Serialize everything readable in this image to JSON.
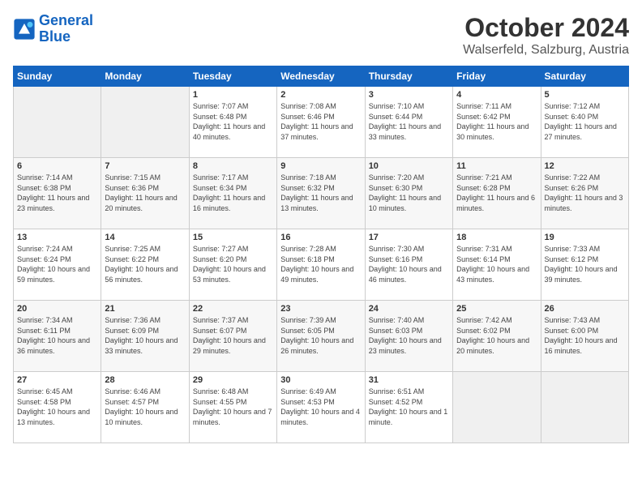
{
  "logo": {
    "line1": "General",
    "line2": "Blue"
  },
  "title": "October 2024",
  "location": "Walserfeld, Salzburg, Austria",
  "days_of_week": [
    "Sunday",
    "Monday",
    "Tuesday",
    "Wednesday",
    "Thursday",
    "Friday",
    "Saturday"
  ],
  "weeks": [
    [
      {
        "day": "",
        "sunrise": "",
        "sunset": "",
        "daylight": ""
      },
      {
        "day": "",
        "sunrise": "",
        "sunset": "",
        "daylight": ""
      },
      {
        "day": "1",
        "sunrise": "Sunrise: 7:07 AM",
        "sunset": "Sunset: 6:48 PM",
        "daylight": "Daylight: 11 hours and 40 minutes."
      },
      {
        "day": "2",
        "sunrise": "Sunrise: 7:08 AM",
        "sunset": "Sunset: 6:46 PM",
        "daylight": "Daylight: 11 hours and 37 minutes."
      },
      {
        "day": "3",
        "sunrise": "Sunrise: 7:10 AM",
        "sunset": "Sunset: 6:44 PM",
        "daylight": "Daylight: 11 hours and 33 minutes."
      },
      {
        "day": "4",
        "sunrise": "Sunrise: 7:11 AM",
        "sunset": "Sunset: 6:42 PM",
        "daylight": "Daylight: 11 hours and 30 minutes."
      },
      {
        "day": "5",
        "sunrise": "Sunrise: 7:12 AM",
        "sunset": "Sunset: 6:40 PM",
        "daylight": "Daylight: 11 hours and 27 minutes."
      }
    ],
    [
      {
        "day": "6",
        "sunrise": "Sunrise: 7:14 AM",
        "sunset": "Sunset: 6:38 PM",
        "daylight": "Daylight: 11 hours and 23 minutes."
      },
      {
        "day": "7",
        "sunrise": "Sunrise: 7:15 AM",
        "sunset": "Sunset: 6:36 PM",
        "daylight": "Daylight: 11 hours and 20 minutes."
      },
      {
        "day": "8",
        "sunrise": "Sunrise: 7:17 AM",
        "sunset": "Sunset: 6:34 PM",
        "daylight": "Daylight: 11 hours and 16 minutes."
      },
      {
        "day": "9",
        "sunrise": "Sunrise: 7:18 AM",
        "sunset": "Sunset: 6:32 PM",
        "daylight": "Daylight: 11 hours and 13 minutes."
      },
      {
        "day": "10",
        "sunrise": "Sunrise: 7:20 AM",
        "sunset": "Sunset: 6:30 PM",
        "daylight": "Daylight: 11 hours and 10 minutes."
      },
      {
        "day": "11",
        "sunrise": "Sunrise: 7:21 AM",
        "sunset": "Sunset: 6:28 PM",
        "daylight": "Daylight: 11 hours and 6 minutes."
      },
      {
        "day": "12",
        "sunrise": "Sunrise: 7:22 AM",
        "sunset": "Sunset: 6:26 PM",
        "daylight": "Daylight: 11 hours and 3 minutes."
      }
    ],
    [
      {
        "day": "13",
        "sunrise": "Sunrise: 7:24 AM",
        "sunset": "Sunset: 6:24 PM",
        "daylight": "Daylight: 10 hours and 59 minutes."
      },
      {
        "day": "14",
        "sunrise": "Sunrise: 7:25 AM",
        "sunset": "Sunset: 6:22 PM",
        "daylight": "Daylight: 10 hours and 56 minutes."
      },
      {
        "day": "15",
        "sunrise": "Sunrise: 7:27 AM",
        "sunset": "Sunset: 6:20 PM",
        "daylight": "Daylight: 10 hours and 53 minutes."
      },
      {
        "day": "16",
        "sunrise": "Sunrise: 7:28 AM",
        "sunset": "Sunset: 6:18 PM",
        "daylight": "Daylight: 10 hours and 49 minutes."
      },
      {
        "day": "17",
        "sunrise": "Sunrise: 7:30 AM",
        "sunset": "Sunset: 6:16 PM",
        "daylight": "Daylight: 10 hours and 46 minutes."
      },
      {
        "day": "18",
        "sunrise": "Sunrise: 7:31 AM",
        "sunset": "Sunset: 6:14 PM",
        "daylight": "Daylight: 10 hours and 43 minutes."
      },
      {
        "day": "19",
        "sunrise": "Sunrise: 7:33 AM",
        "sunset": "Sunset: 6:12 PM",
        "daylight": "Daylight: 10 hours and 39 minutes."
      }
    ],
    [
      {
        "day": "20",
        "sunrise": "Sunrise: 7:34 AM",
        "sunset": "Sunset: 6:11 PM",
        "daylight": "Daylight: 10 hours and 36 minutes."
      },
      {
        "day": "21",
        "sunrise": "Sunrise: 7:36 AM",
        "sunset": "Sunset: 6:09 PM",
        "daylight": "Daylight: 10 hours and 33 minutes."
      },
      {
        "day": "22",
        "sunrise": "Sunrise: 7:37 AM",
        "sunset": "Sunset: 6:07 PM",
        "daylight": "Daylight: 10 hours and 29 minutes."
      },
      {
        "day": "23",
        "sunrise": "Sunrise: 7:39 AM",
        "sunset": "Sunset: 6:05 PM",
        "daylight": "Daylight: 10 hours and 26 minutes."
      },
      {
        "day": "24",
        "sunrise": "Sunrise: 7:40 AM",
        "sunset": "Sunset: 6:03 PM",
        "daylight": "Daylight: 10 hours and 23 minutes."
      },
      {
        "day": "25",
        "sunrise": "Sunrise: 7:42 AM",
        "sunset": "Sunset: 6:02 PM",
        "daylight": "Daylight: 10 hours and 20 minutes."
      },
      {
        "day": "26",
        "sunrise": "Sunrise: 7:43 AM",
        "sunset": "Sunset: 6:00 PM",
        "daylight": "Daylight: 10 hours and 16 minutes."
      }
    ],
    [
      {
        "day": "27",
        "sunrise": "Sunrise: 6:45 AM",
        "sunset": "Sunset: 4:58 PM",
        "daylight": "Daylight: 10 hours and 13 minutes."
      },
      {
        "day": "28",
        "sunrise": "Sunrise: 6:46 AM",
        "sunset": "Sunset: 4:57 PM",
        "daylight": "Daylight: 10 hours and 10 minutes."
      },
      {
        "day": "29",
        "sunrise": "Sunrise: 6:48 AM",
        "sunset": "Sunset: 4:55 PM",
        "daylight": "Daylight: 10 hours and 7 minutes."
      },
      {
        "day": "30",
        "sunrise": "Sunrise: 6:49 AM",
        "sunset": "Sunset: 4:53 PM",
        "daylight": "Daylight: 10 hours and 4 minutes."
      },
      {
        "day": "31",
        "sunrise": "Sunrise: 6:51 AM",
        "sunset": "Sunset: 4:52 PM",
        "daylight": "Daylight: 10 hours and 1 minute."
      },
      {
        "day": "",
        "sunrise": "",
        "sunset": "",
        "daylight": ""
      },
      {
        "day": "",
        "sunrise": "",
        "sunset": "",
        "daylight": ""
      }
    ]
  ]
}
